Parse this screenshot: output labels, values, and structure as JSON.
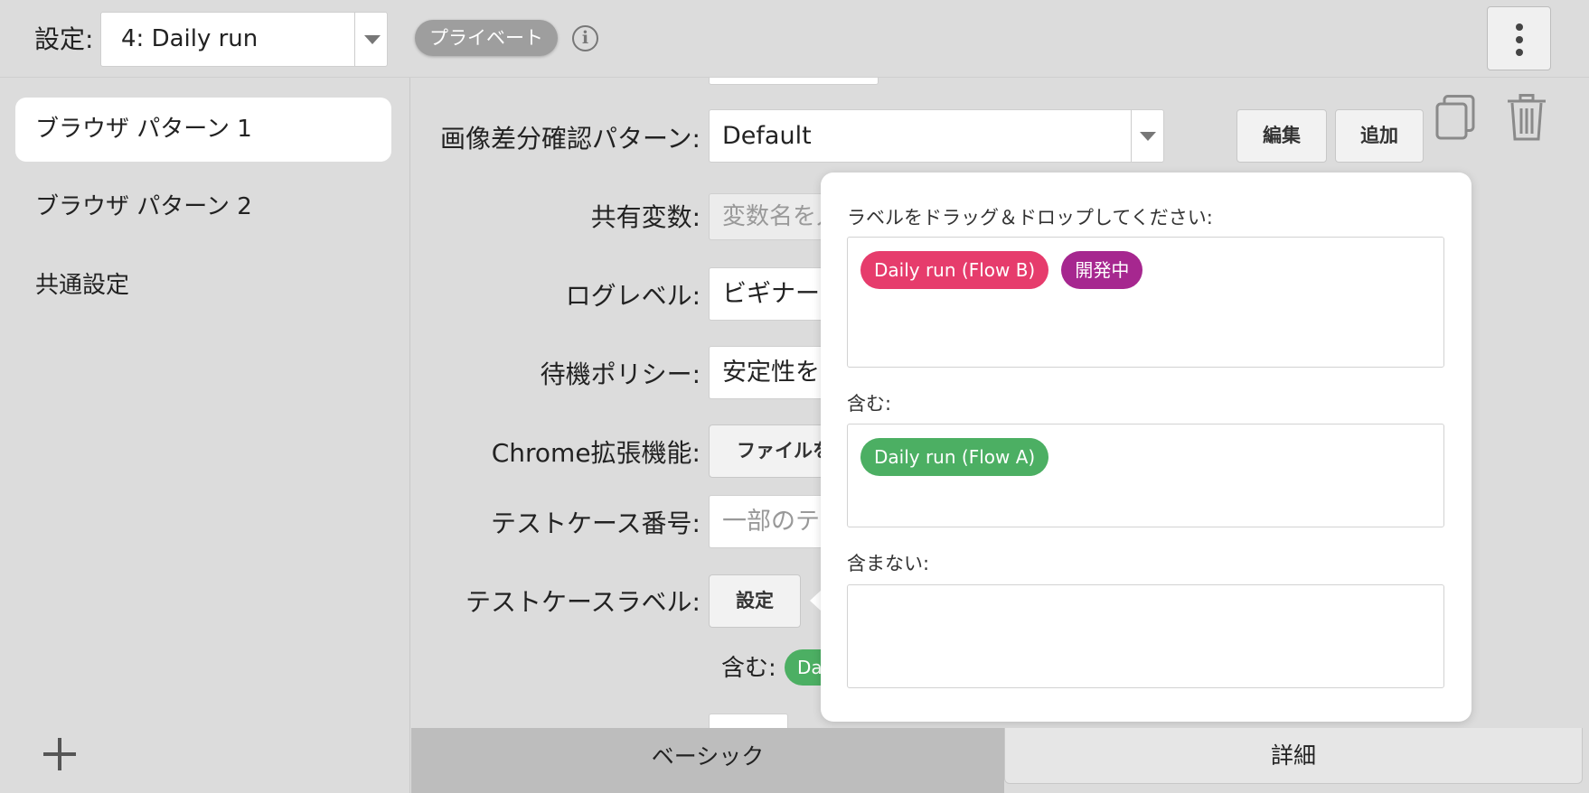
{
  "header": {
    "settings_label": "設定:",
    "settings_selected": "4: Daily run",
    "privacy_badge": "プライベート",
    "info_icon": "info-icon",
    "more_icon": "more-vertical-icon"
  },
  "sidebar": {
    "items": [
      {
        "label": "ブラウザ パターン 1",
        "active": true
      },
      {
        "label": "ブラウザ パターン 2",
        "active": false
      },
      {
        "label": "共通設定",
        "active": false
      }
    ],
    "add_icon": "plus-icon"
  },
  "form": {
    "image_diff": {
      "label": "画像差分確認パターン:",
      "value": "Default",
      "edit_label": "編集",
      "add_label": "追加"
    },
    "shared_vars": {
      "label": "共有変数:",
      "placeholder": "変数名を入"
    },
    "log_level": {
      "label": "ログレベル:",
      "value": "ビギナー"
    },
    "wait_policy": {
      "label": "待機ポリシー:",
      "value": "安定性を"
    },
    "chrome_ext": {
      "label": "Chrome拡張機能:",
      "button_label": "ファイルを"
    },
    "testcase_number": {
      "label": "テストケース番号:",
      "placeholder": "一部のテス"
    },
    "testcase_label": {
      "label": "テストケースラベル:",
      "button_label": "設定"
    },
    "include_summary": {
      "label": "含む:",
      "tag_fragment": "Da"
    }
  },
  "popover": {
    "instruction": "ラベルをドラッグ＆ドロップしてください:",
    "available_tags": [
      {
        "label": "Daily run (Flow B)",
        "color": "#e63c6c"
      },
      {
        "label": "開発中",
        "color": "#a6278f"
      }
    ],
    "include_label": "含む:",
    "include_tags": [
      {
        "label": "Daily run (Flow A)",
        "color": "#4caf63"
      }
    ],
    "exclude_label": "含まない:"
  },
  "tabs": {
    "basic": "ベーシック",
    "detail": "詳細"
  },
  "colors": {
    "background": "#dcdcdc",
    "green_tag": "#4caf63",
    "red_tag": "#e63c6c",
    "purple_tag": "#a6278f"
  }
}
